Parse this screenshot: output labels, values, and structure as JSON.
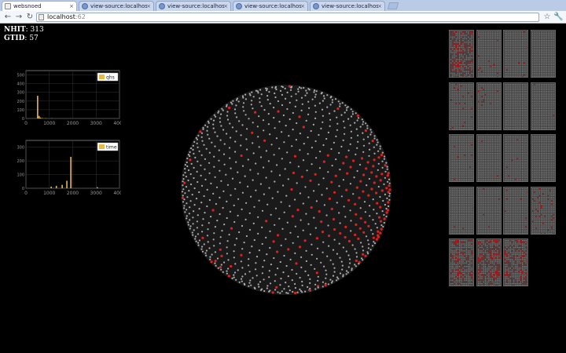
{
  "browser": {
    "tabs": [
      {
        "title": "websnoed",
        "active": true
      },
      {
        "title": "view-source:localhost:",
        "active": false
      },
      {
        "title": "view-source:localhost:",
        "active": false
      },
      {
        "title": "view-source:localhost:",
        "active": false
      },
      {
        "title": "view-source:localhost:",
        "active": false
      }
    ],
    "close_glyph": "×",
    "url_host": "localhost",
    "url_port": ":62",
    "icons": [
      "back-icon",
      "forward-icon",
      "reload-icon",
      "star-icon",
      "wrench-icon"
    ]
  },
  "stats": {
    "nhit_label": "NHIT",
    "nhit_value": "313",
    "gtid_label": "GTID",
    "gtid_value": "57"
  },
  "chart_data": [
    {
      "type": "bar",
      "legend": "qhs",
      "legend_position": "top-right",
      "xlim": [
        0,
        4000
      ],
      "ylim": [
        0,
        550
      ],
      "x_ticks": [
        "0",
        "1000",
        "2000",
        "3000",
        "4000"
      ],
      "y_ticks": [
        "0",
        "100",
        "200",
        "300",
        "400",
        "500"
      ],
      "grid": true,
      "color": "#e8b84a",
      "x": [
        500,
        560,
        620,
        700,
        850,
        1100
      ],
      "values": [
        260,
        30,
        10,
        4,
        3,
        2
      ]
    },
    {
      "type": "bar",
      "legend": "time",
      "legend_position": "top-right",
      "xlim": [
        0,
        4000
      ],
      "ylim": [
        0,
        350
      ],
      "x_ticks": [
        "0",
        "1000",
        "2000",
        "3000",
        "4000"
      ],
      "y_ticks": [
        "0",
        "100",
        "200",
        "300"
      ],
      "grid": true,
      "color": "#e8b84a",
      "x": [
        1080,
        1300,
        1550,
        1750,
        1920,
        3050
      ],
      "values": [
        12,
        18,
        25,
        55,
        230,
        8
      ]
    }
  ],
  "detector": {
    "pmt_color": "#c8c8c8",
    "hit_color": "#e02020"
  },
  "crates": {
    "count": 19,
    "hit_fraction": [
      0.45,
      0.02,
      0.01,
      0.0,
      0.05,
      0.02,
      0.0,
      0.01,
      0.02,
      0.01,
      0.01,
      0.0,
      0.01,
      0.02,
      0.02,
      0.08,
      0.35,
      0.4,
      0.3
    ]
  }
}
